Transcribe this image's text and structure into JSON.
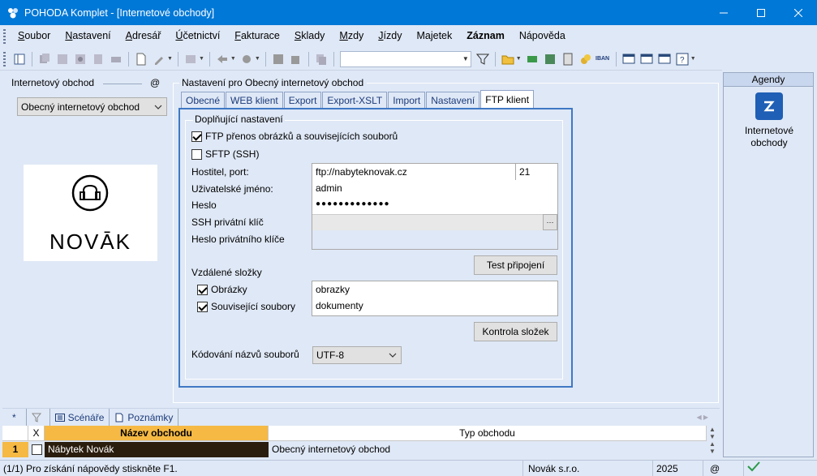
{
  "window": {
    "title": "POHODA Komplet - [Internetové obchody]"
  },
  "menu": {
    "items": [
      {
        "label": "Soubor",
        "underline": "S",
        "rest": "oubor"
      },
      {
        "label": "Nastavení",
        "underline": "N",
        "rest": "astavení"
      },
      {
        "label": "Adresář",
        "underline": "A",
        "rest": "dresář"
      },
      {
        "label": "Účetnictví",
        "underline": "Ú",
        "rest": "četnictví"
      },
      {
        "label": "Fakturace",
        "underline": "F",
        "rest": "akturace"
      },
      {
        "label": "Sklady",
        "underline": "S",
        "rest": "klady"
      },
      {
        "label": "Mzdy",
        "underline": "M",
        "rest": "zdy"
      },
      {
        "label": "Jízdy",
        "underline": "J",
        "rest": "ízdy"
      },
      {
        "label": "Majetek",
        "underline": "",
        "rest": "Majetek"
      },
      {
        "label": "Záznam",
        "underline": "",
        "rest": "Záznam"
      },
      {
        "label": "Nápověda",
        "underline": "",
        "rest": "Nápověda"
      }
    ]
  },
  "left_panel": {
    "header": "Internetový obchod",
    "at_sign": "@",
    "shop_select_value": "Obecný internetový obchod",
    "logo_text": "NOVĀK"
  },
  "settings": {
    "title": "Nastavení pro Obecný internetový obchod",
    "tabs": [
      "Obecné",
      "WEB klient",
      "Export",
      "Export-XSLT",
      "Import",
      "Nastavení",
      "FTP klient"
    ],
    "active_tab": "FTP klient",
    "group_title": "Doplňující nastavení",
    "ftp_transfer_label": "FTP přenos obrázků a souvisejících souborů",
    "ftp_transfer_checked": true,
    "sftp_label": "SFTP (SSH)",
    "sftp_checked": false,
    "host_label": "Hostitel, port:",
    "host_value": "ftp://nabyteknovak.cz",
    "port_value": "21",
    "user_label": "Uživatelské jméno:",
    "user_value": "admin",
    "password_label": "Heslo",
    "password_value": "●●●●●●●●●●●●●",
    "ssh_key_label": "SSH privátní klíč",
    "ssh_key_button": "···",
    "key_password_label": "Heslo privátního klíče",
    "test_button": "Test připojení",
    "remote_folders_label": "Vzdálené složky",
    "images_label": "Obrázky",
    "images_checked": true,
    "images_folder": "obrazky",
    "related_label": "Související soubory",
    "related_checked": true,
    "related_folder": "dokumenty",
    "check_folders_button": "Kontrola složek",
    "encoding_label": "Kódování názvů souborů",
    "encoding_value": "UTF-8"
  },
  "agenda": {
    "header": "Agendy",
    "item_line1": "Internetové",
    "item_line2": "obchody"
  },
  "bottom_tabs": {
    "star": "*",
    "scenarios": "Scénáře",
    "notes": "Poznámky"
  },
  "grid": {
    "col_x": "X",
    "col_name": "Název obchodu",
    "col_type": "Typ obchodu",
    "rows": [
      {
        "num": "1",
        "name": "Nábytek Novák",
        "type": "Obecný internetový obchod"
      }
    ]
  },
  "status": {
    "hint": "(1/1) Pro získání nápovědy stiskněte F1.",
    "company": "Novák s.r.o.",
    "year": "2025",
    "at": "@"
  },
  "colors": {
    "titlebar": "#0078d7",
    "accent_tab": "#3f78c4",
    "grid_header_highlight": "#f5b944",
    "grid_selected_row": "#2b1d0e"
  }
}
